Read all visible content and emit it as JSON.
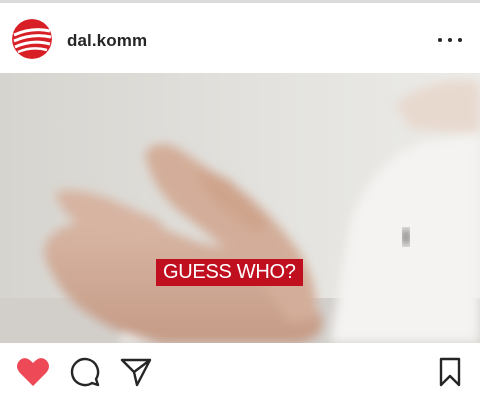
{
  "post": {
    "username": "dal.komm",
    "more_icon": "more-horizontal-icon",
    "avatar_icon": "dal-komm-logo-icon",
    "overlay_text": "GUESS WHO?"
  },
  "actions": {
    "like_icon": "heart-filled-icon",
    "comment_icon": "comment-bubble-icon",
    "share_icon": "paper-plane-icon",
    "save_icon": "bookmark-icon",
    "like_state": "liked"
  },
  "colors": {
    "liked_heart": "#ed4956",
    "overlay_bg": "#c0101f",
    "text": "#262626",
    "brand_red": "#d81f26"
  }
}
